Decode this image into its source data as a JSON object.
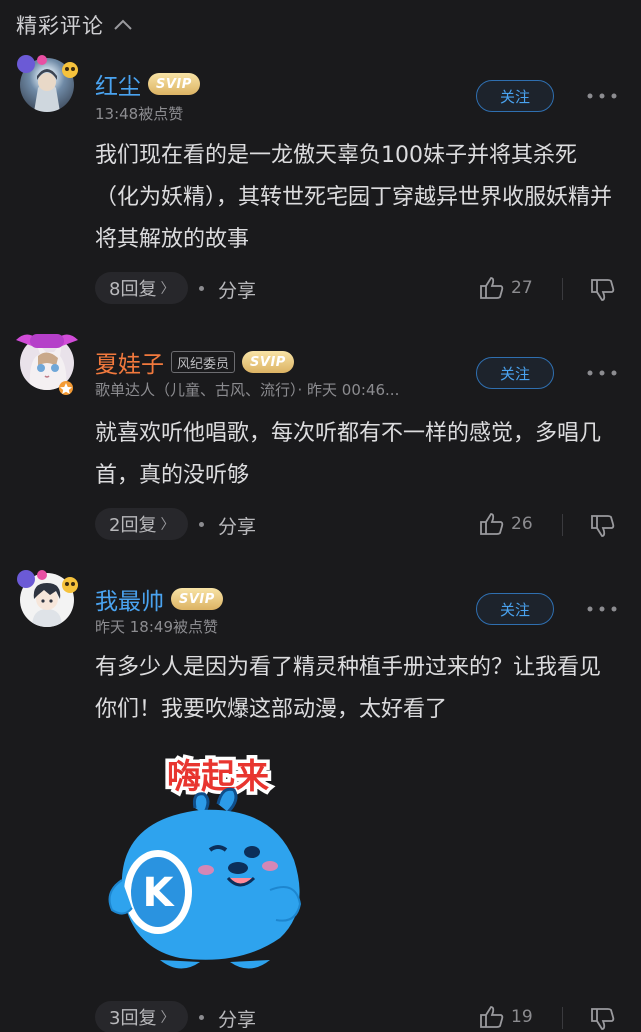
{
  "header": {
    "title": "精彩评论",
    "icon": "chevron-up-icon"
  },
  "comments": [
    {
      "name": "红尘",
      "name_color": "#4aa3f0",
      "svip": "SVIP",
      "sub": "13:48被点赞",
      "follow": "关注",
      "text": "我们现在看的是一龙傲天辜负100妹子并将其杀死（化为妖精），其转世死宅园丁穿越异世界收服妖精并将其解放的故事",
      "replies": "8回复",
      "share": "分享",
      "likes": "27"
    },
    {
      "name": "夏娃子",
      "name_color": "#f2793d",
      "role": "风纪委员",
      "svip": "SVIP",
      "sub": "歌单达人（儿童、古风、流行）· 昨天 00:46...",
      "follow": "关注",
      "text": "就喜欢听他唱歌，每次听都有不一样的感觉，多唱几首，真的没听够",
      "replies": "2回复",
      "share": "分享",
      "likes": "26"
    },
    {
      "name": "我最帅",
      "name_color": "#4aa3f0",
      "svip": "SVIP",
      "sub": "昨天 18:49被点赞",
      "follow": "关注",
      "text": "有多少人是因为看了精灵种植手册过来的？让我看见你们！我要吹爆这部动漫，太好看了",
      "sticker_text": "嗨起来",
      "sticker_badge": "K",
      "replies": "3回复",
      "share": "分享",
      "likes": "19"
    }
  ],
  "colors": {
    "background": "#1a1a1c",
    "accent": "#4aa3f0",
    "svip_gold": "#dcb363"
  }
}
